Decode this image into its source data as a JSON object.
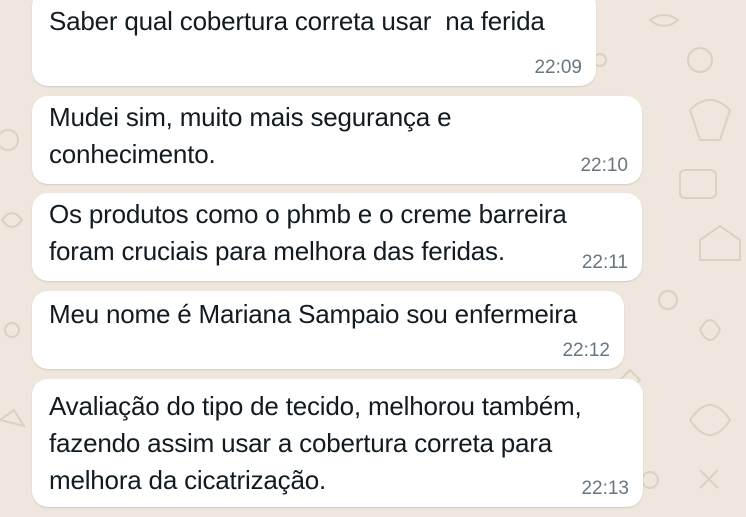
{
  "colors": {
    "background": "#efe7dd",
    "bubble": "#ffffff",
    "text": "#111b21",
    "timestamp": "#667781",
    "doodle": "#d9cfc1"
  },
  "messages": [
    {
      "text": "Saber qual cobertura correta usar  na ferida",
      "time": "22:09"
    },
    {
      "text": "Mudei sim, muito mais segurança e\nconhecimento.",
      "time": "22:10"
    },
    {
      "text": "Os produtos como o phmb e o creme barreira\nforam cruciais para melhora das feridas.",
      "time": "22:11"
    },
    {
      "text": "Meu nome é Mariana Sampaio sou enfermeira",
      "time": "22:12"
    },
    {
      "text": "Avaliação do tipo de tecido, melhorou também,\nfazendo assim usar a cobertura correta para\nmelhora da cicatrização.",
      "time": "22:13"
    }
  ]
}
